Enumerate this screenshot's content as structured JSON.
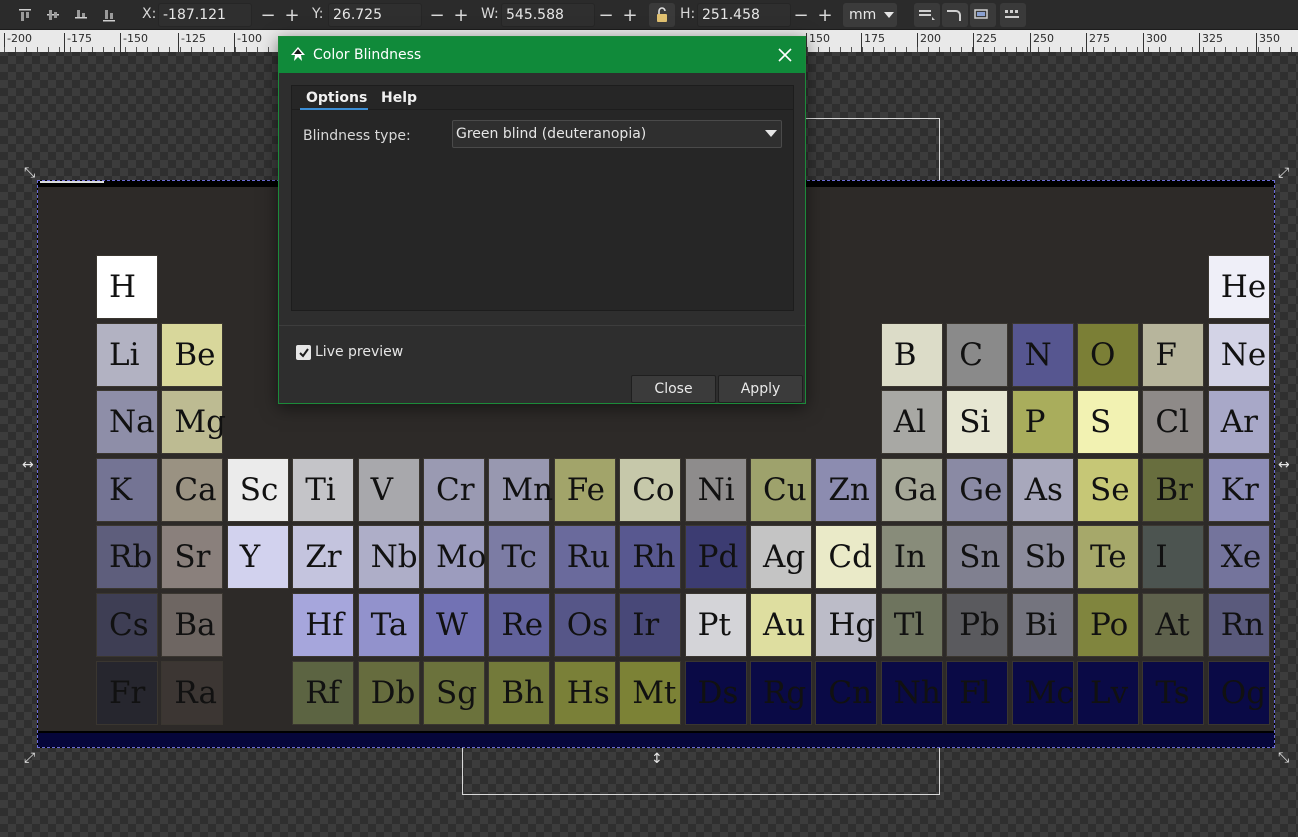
{
  "toolbar": {
    "x_label": "X:",
    "x_value": "-187.121",
    "y_label": "Y:",
    "y_value": "26.725",
    "w_label": "W:",
    "w_value": "545.588",
    "h_label": "H:",
    "h_value": "251.458",
    "minus": "−",
    "plus": "+",
    "unit": "mm"
  },
  "ruler": {
    "labels": [
      "-200",
      "-175",
      "-150",
      "-125",
      "-100",
      "150",
      "175",
      "200",
      "225",
      "250",
      "275",
      "300",
      "325",
      "350"
    ]
  },
  "dialog": {
    "title": "Color Blindness",
    "tabs": [
      "Options",
      "Help"
    ],
    "blindness_label": "Blindness type:",
    "blindness_value": "Green blind (deuteranopia)",
    "live_preview_label": "Live preview",
    "live_preview_checked": true,
    "close_label": "Close",
    "apply_label": "Apply"
  },
  "colors": {
    "title_bar": "#108a3a",
    "tab_underline": "#3b8ed6"
  },
  "elements": [
    {
      "s": "H",
      "c": "#ffffff"
    },
    {
      "s": "He",
      "c": "#efeff8"
    },
    {
      "s": "Li",
      "c": "#b2b2c2"
    },
    {
      "s": "Be",
      "c": "#d8d79b"
    },
    {
      "s": "B",
      "c": "#dcdcc8"
    },
    {
      "s": "C",
      "c": "#8a8a8a"
    },
    {
      "s": "N",
      "c": "#565690"
    },
    {
      "s": "O",
      "c": "#7b7f36"
    },
    {
      "s": "F",
      "c": "#b7b59c"
    },
    {
      "s": "Ne",
      "c": "#d3d3e6"
    },
    {
      "s": "Na",
      "c": "#8e8ea8"
    },
    {
      "s": "Mg",
      "c": "#bdbb92"
    },
    {
      "s": "Al",
      "c": "#a8a8a4"
    },
    {
      "s": "Si",
      "c": "#e6e6d2"
    },
    {
      "s": "P",
      "c": "#a9ad5c"
    },
    {
      "s": "S",
      "c": "#f2f2b2"
    },
    {
      "s": "Cl",
      "c": "#8e8a88"
    },
    {
      "s": "Ar",
      "c": "#a8a8c8"
    },
    {
      "s": "K",
      "c": "#747494"
    },
    {
      "s": "Ca",
      "c": "#9a9282"
    },
    {
      "s": "Sc",
      "c": "#ebebeb"
    },
    {
      "s": "Ti",
      "c": "#c4c4c8"
    },
    {
      "s": "V",
      "c": "#a8a8ac"
    },
    {
      "s": "Cr",
      "c": "#9a9ab2"
    },
    {
      "s": "Mn",
      "c": "#9898b0"
    },
    {
      "s": "Fe",
      "c": "#a2a46a"
    },
    {
      "s": "Co",
      "c": "#c6c8aa"
    },
    {
      "s": "Ni",
      "c": "#8e8c8c"
    },
    {
      "s": "Cu",
      "c": "#9ea26c"
    },
    {
      "s": "Zn",
      "c": "#8c8cb0"
    },
    {
      "s": "Ga",
      "c": "#a6a898"
    },
    {
      "s": "Ge",
      "c": "#8a8aa4"
    },
    {
      "s": "As",
      "c": "#a8a8bc"
    },
    {
      "s": "Se",
      "c": "#c6c776"
    },
    {
      "s": "Br",
      "c": "#686e3e"
    },
    {
      "s": "Kr",
      "c": "#8e8eb8"
    },
    {
      "s": "Rb",
      "c": "#5e5e7c"
    },
    {
      "s": "Sr",
      "c": "#8a807c"
    },
    {
      "s": "Y",
      "c": "#d2d2ee"
    },
    {
      "s": "Zr",
      "c": "#c4c4de"
    },
    {
      "s": "Nb",
      "c": "#aeaec8"
    },
    {
      "s": "Mo",
      "c": "#9c9cbe"
    },
    {
      "s": "Tc",
      "c": "#7c7ca4"
    },
    {
      "s": "Ru",
      "c": "#6a6a9c"
    },
    {
      "s": "Rh",
      "c": "#585890"
    },
    {
      "s": "Pd",
      "c": "#3c3c72"
    },
    {
      "s": "Ag",
      "c": "#c4c4c4"
    },
    {
      "s": "Cd",
      "c": "#eaeac8"
    },
    {
      "s": "In",
      "c": "#888c7a"
    },
    {
      "s": "Sn",
      "c": "#808090"
    },
    {
      "s": "Sb",
      "c": "#8c8c9c"
    },
    {
      "s": "Te",
      "c": "#a6a86a"
    },
    {
      "s": "I",
      "c": "#4c5450"
    },
    {
      "s": "Xe",
      "c": "#74749c"
    },
    {
      "s": "Cs",
      "c": "#3e3e54"
    },
    {
      "s": "Ba",
      "c": "#6e6662"
    },
    {
      "s": "Hf",
      "c": "#a6a6dc"
    },
    {
      "s": "Ta",
      "c": "#9292cc"
    },
    {
      "s": "W",
      "c": "#7272b4"
    },
    {
      "s": "Re",
      "c": "#62629c"
    },
    {
      "s": "Os",
      "c": "#565688"
    },
    {
      "s": "Ir",
      "c": "#484878"
    },
    {
      "s": "Pt",
      "c": "#d4d4d8"
    },
    {
      "s": "Au",
      "c": "#dedea0"
    },
    {
      "s": "Hg",
      "c": "#bcbcc8"
    },
    {
      "s": "Tl",
      "c": "#6e745e"
    },
    {
      "s": "Pb",
      "c": "#5a5a5e"
    },
    {
      "s": "Bi",
      "c": "#74747e"
    },
    {
      "s": "Po",
      "c": "#80853e"
    },
    {
      "s": "At",
      "c": "#5e614c"
    },
    {
      "s": "Rn",
      "c": "#5a5a7c"
    },
    {
      "s": "Fr",
      "c": "#26262e"
    },
    {
      "s": "Ra",
      "c": "#3c3633"
    },
    {
      "s": "Rf",
      "c": "#5c6442"
    },
    {
      "s": "Db",
      "c": "#666c3e"
    },
    {
      "s": "Sg",
      "c": "#6b723c"
    },
    {
      "s": "Bh",
      "c": "#737a3a"
    },
    {
      "s": "Hs",
      "c": "#7a8038"
    },
    {
      "s": "Mt",
      "c": "#7c8236"
    },
    {
      "s": "Ds",
      "c": "#0a0a46"
    },
    {
      "s": "Rg",
      "c": "#0a0a46"
    },
    {
      "s": "Cn",
      "c": "#0a0a46"
    },
    {
      "s": "Nh",
      "c": "#0a0a46"
    },
    {
      "s": "Fl",
      "c": "#0a0a46"
    },
    {
      "s": "Mc",
      "c": "#0a0a46"
    },
    {
      "s": "Lv",
      "c": "#0a0a46"
    },
    {
      "s": "Ts",
      "c": "#0a0a46"
    },
    {
      "s": "Og",
      "c": "#0a0a46"
    }
  ]
}
